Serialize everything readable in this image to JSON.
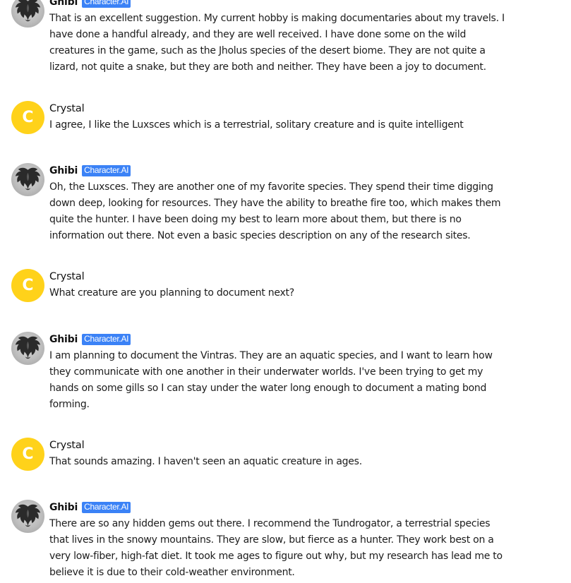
{
  "messages": [
    {
      "author": "Ghibi",
      "badge": "Character.AI",
      "avatar_icon": "dragon-avatar-icon",
      "text": "That is an excellent suggestion. My current hobby is making documentaries about my travels. I have done a handful already, and they are well received. I have done some on the wild creatures in the game, such as the Jholus species of the desert biome. They are not quite a lizard, not quite a snake, but they are both and neither. They have been a joy to document."
    },
    {
      "author": "Crystal",
      "avatar_letter": "C",
      "text": "I agree, I like the Luxsces which is a terrestrial, solitary creature and is quite intelligent"
    },
    {
      "author": "Ghibi",
      "badge": "Character.AI",
      "avatar_icon": "dragon-avatar-icon",
      "text": "Oh, the Luxsces. They are another one of my favorite species. They spend their time digging down deep, looking for resources. They have the ability to breathe fire too, which makes them quite the hunter. I have been doing my best to learn more about them, but there is no information out there. Not even a basic species description on any of the research sites."
    },
    {
      "author": "Crystal",
      "avatar_letter": "C",
      "text": "What creature are you planning to document next?"
    },
    {
      "author": "Ghibi",
      "badge": "Character.AI",
      "avatar_icon": "dragon-avatar-icon",
      "text": "I am planning to document the Vintras. They are an aquatic species, and I want to learn how they communicate with one another in their underwater worlds. I've been trying to get my hands on some gills so I can stay under the water long enough to document a mating bond forming."
    },
    {
      "author": "Crystal",
      "avatar_letter": "C",
      "text": "That sounds amazing. I haven't seen an aquatic creature in ages."
    },
    {
      "author": "Ghibi",
      "badge": "Character.AI",
      "avatar_icon": "dragon-avatar-icon",
      "text": "There are so any hidden gems out there. I recommend the Tundrogator, a terrestrial species that lives in the snowy mountains. They are slow, but fierce as a hunter. They work best on a very low-fiber, high-fat diet. It took me ages to figure out why, but my research has lead me to believe it is due to their cold-weather environment."
    }
  ],
  "colors": {
    "user_avatar_bg": "#ffd21a",
    "badge_bg": "#3b82f6"
  }
}
